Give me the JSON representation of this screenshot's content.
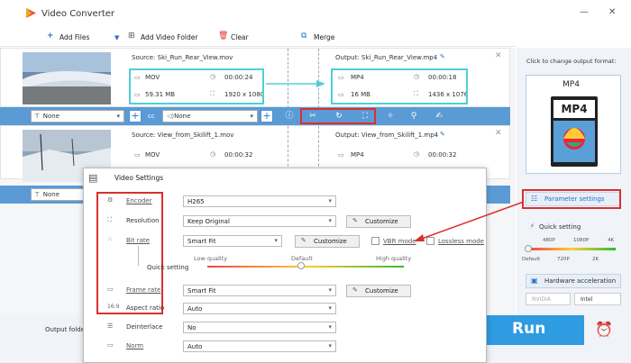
{
  "app": {
    "title": "Video Converter"
  },
  "toolbar": {
    "add_files": "Add Files",
    "add_folder": "Add Video Folder",
    "clear": "Clear",
    "merge": "Merge"
  },
  "files": [
    {
      "source": "Source: Ski_Run_Rear_View.mov",
      "src_format": "MOV",
      "src_duration": "00:00:24",
      "src_size": "59.31 MB",
      "src_res": "1920 x 1080",
      "output": "Output: Ski_Run_Rear_View.mp4",
      "out_format": "MP4",
      "out_duration": "00:00:18",
      "out_size": "16 MB",
      "out_res": "1436 x 1076",
      "subtitle": "None",
      "audio": "None"
    },
    {
      "source": "Source: View_from_Skilift_1.mov",
      "src_format": "MOV",
      "src_duration": "00:00:32",
      "output": "Output: View_from_Skilift_1.mp4",
      "out_format": "MP4",
      "out_duration": "00:00:32",
      "subtitle": "None"
    }
  ],
  "right_panel": {
    "click_label": "Click to change output format:",
    "format": "MP4",
    "format_logo": "MP4",
    "param_settings": "Parameter settings",
    "quick_setting": "Quick setting",
    "ticks_top": [
      "480P",
      "1080P",
      "4K"
    ],
    "ticks_bottom": [
      "Default",
      "720P",
      "2K"
    ],
    "hw_accel": "Hardware acceleration",
    "nvidia": "NVIDIA",
    "intel": "Intel"
  },
  "settings": {
    "title": "Video Settings",
    "encoder_label": "Encoder",
    "encoder_value": "H265",
    "resolution_label": "Resolution",
    "resolution_value": "Keep Original",
    "customize": "Customize",
    "bitrate_label": "Bit rate",
    "bitrate_value": "Smart Fit",
    "vbr_label": "VBR mode",
    "lossless_label": "Lossless mode",
    "quick_setting_label": "Quick setting",
    "low_quality": "Low quality",
    "default": "Default",
    "high_quality": "High quality",
    "framerate_label": "Frame rate",
    "framerate_value": "Smart Fit",
    "aspect_label": "Aspect ratio",
    "aspect_value": "Auto",
    "deinterlace_label": "Deinterlace",
    "deinterlace_value": "No",
    "norm_label": "Norm",
    "norm_value": "Auto"
  },
  "bottom": {
    "output_folder": "Output folder:",
    "run": "Run"
  },
  "colors": {
    "accent": "#4a90d9",
    "highlight_cyan": "#4ed0d8",
    "highlight_red": "#d93030",
    "run_bg": "#2f9be0",
    "edit_bar": "#5b9bd5"
  }
}
